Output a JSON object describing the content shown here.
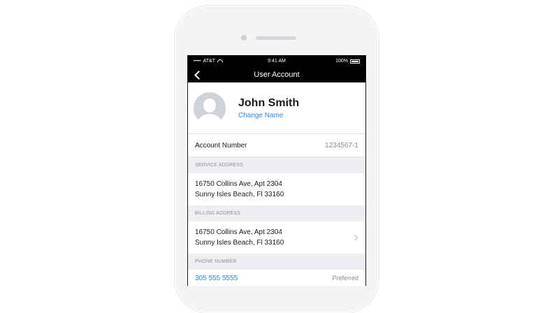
{
  "status_bar": {
    "carrier": "AT&T",
    "signal": "•••••",
    "time": "9:41 AM",
    "battery": "100%"
  },
  "nav": {
    "title": "User Account"
  },
  "profile": {
    "name": "John Smith",
    "change_name_label": "Change Name"
  },
  "account": {
    "label": "Account Number",
    "value": "1234567-1"
  },
  "service_address": {
    "header": "SERVICE ADDRESS",
    "line1": "16750 Collins Ave, Apt 2304",
    "line2": "Sunny Isles Beach, Fl 33160"
  },
  "billing_address": {
    "header": "BILLING ADDRESS",
    "line1": "16750 Collins Ave, Apt 2304",
    "line2": "Sunny Isles Beach, Fl 33160"
  },
  "phone_number": {
    "header": "PHONE NUMBER",
    "number": "305 555 5555",
    "tag": "Preferred"
  },
  "icons": [
    "chevron-left-icon",
    "wifi-icon",
    "battery-icon",
    "avatar-icon",
    "chevron-right-icon"
  ],
  "colors": {
    "link": "#2e86de",
    "nav_bg": "#000000",
    "section_bg": "#efeff3"
  }
}
